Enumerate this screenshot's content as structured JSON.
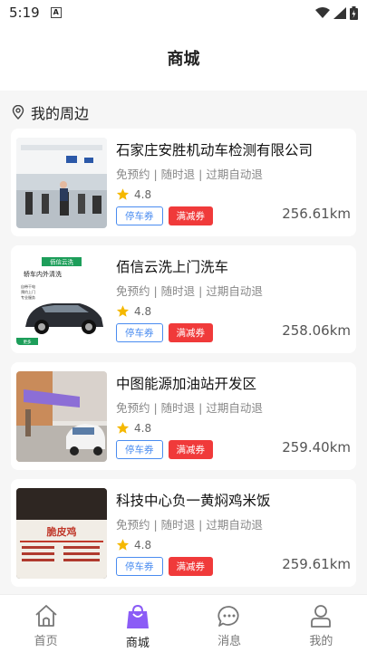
{
  "status": {
    "time": "5:19"
  },
  "header": {
    "title": "商城"
  },
  "section": {
    "title": "我的周边"
  },
  "shops": [
    {
      "name": "石家庄安胜机动车检测有限公司",
      "tags": "免预约 | 随时退 | 过期自动退",
      "rating": "4.8",
      "btn_park": "停车券",
      "btn_discount": "满减券",
      "distance": "256.61km"
    },
    {
      "name": "佰信云洗上门洗车",
      "tags": "免预约 | 随时退 | 过期自动退",
      "rating": "4.8",
      "btn_park": "停车券",
      "btn_discount": "满减券",
      "distance": "258.06km",
      "thumb_text": {
        "brand": "佰信云洗",
        "line1": "轿车内外清洗",
        "l2": "自带干电",
        "l3": "预约上门",
        "l4": "专业服务",
        "tag": "更多"
      }
    },
    {
      "name": "中图能源加油站开发区",
      "tags": "免预约 | 随时退 | 过期自动退",
      "rating": "4.8",
      "btn_park": "停车券",
      "btn_discount": "满减券",
      "distance": "259.40km"
    },
    {
      "name": "科技中心负一黄焖鸡米饭",
      "tags": "免预约 | 随时退 | 过期自动退",
      "rating": "4.8",
      "btn_park": "停车券",
      "btn_discount": "满减券",
      "distance": "259.61km",
      "thumb_text": {
        "sign": "脆皮鸡"
      }
    }
  ],
  "tabs": [
    {
      "label": "首页",
      "icon": "home-icon"
    },
    {
      "label": "商城",
      "icon": "shop-bag-icon"
    },
    {
      "label": "消息",
      "icon": "message-icon"
    },
    {
      "label": "我的",
      "icon": "user-icon"
    }
  ],
  "colors": {
    "accent": "#8b5cf6",
    "park": "#4a8cf0",
    "discount": "#f03a3a",
    "star": "#f5b800"
  }
}
